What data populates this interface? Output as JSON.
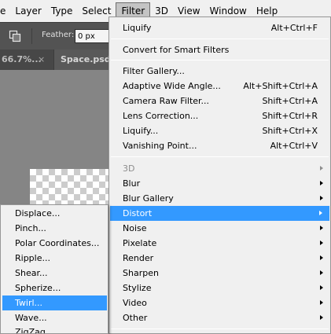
{
  "menubar": {
    "items": [
      "e",
      "Layer",
      "Type",
      "Select",
      "Filter",
      "3D",
      "View",
      "Window",
      "Help"
    ],
    "active_item": "Filter"
  },
  "options_bar": {
    "feather_label": "Feather:",
    "feather_value": "0 px"
  },
  "document_tabs": {
    "tab1_label": "66.7%...",
    "tab1_close": "×",
    "tab2_label": "Space.psd @"
  },
  "filter_menu": {
    "last_filter": {
      "label": "Liquify",
      "shortcut": "Alt+Ctrl+F"
    },
    "convert_smart": {
      "label": "Convert for Smart Filters"
    },
    "filter_gallery": {
      "label": "Filter Gallery..."
    },
    "adaptive_wide_angle": {
      "label": "Adaptive Wide Angle...",
      "shortcut": "Alt+Shift+Ctrl+A"
    },
    "camera_raw": {
      "label": "Camera Raw Filter...",
      "shortcut": "Shift+Ctrl+A"
    },
    "lens_correction": {
      "label": "Lens Correction...",
      "shortcut": "Shift+Ctrl+R"
    },
    "liquify": {
      "label": "Liquify...",
      "shortcut": "Shift+Ctrl+X"
    },
    "vanishing_point": {
      "label": "Vanishing Point...",
      "shortcut": "Alt+Ctrl+V"
    },
    "categories": {
      "3d": "3D",
      "blur": "Blur",
      "blur_gallery": "Blur Gallery",
      "distort": "Distort",
      "noise": "Noise",
      "pixelate": "Pixelate",
      "render": "Render",
      "sharpen": "Sharpen",
      "stylize": "Stylize",
      "video": "Video",
      "other": "Other"
    },
    "highlighted": "Distort",
    "disabled": [
      "3D"
    ]
  },
  "distort_submenu": {
    "displace": "Displace...",
    "pinch": "Pinch...",
    "polar_coordinates": "Polar Coordinates...",
    "ripple": "Ripple...",
    "shear": "Shear...",
    "spherize": "Spherize...",
    "twirl": "Twirl...",
    "wave": "Wave...",
    "zigzag": "ZigZag",
    "highlighted": "Twirl..."
  },
  "colors": {
    "menu_bg": "#f0f0f0",
    "highlight": "#3399ff",
    "ui_dark": "#535353",
    "canvas_bg": "#858585"
  }
}
